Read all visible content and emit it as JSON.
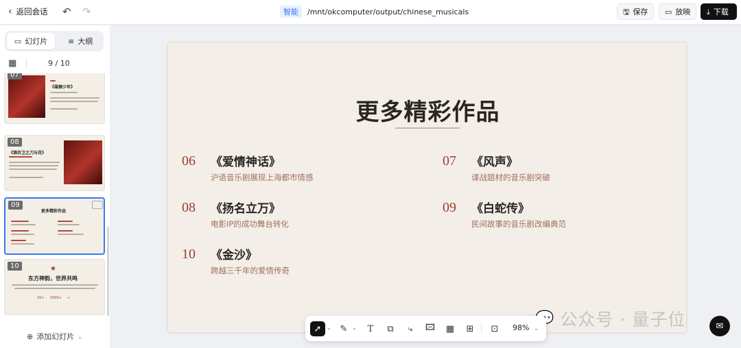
{
  "topbar": {
    "back_label": "返回会话",
    "mode_badge": "智能",
    "path": "/mnt/okcomputer/output/chinese_musicals",
    "save_label": "保存",
    "present_label": "放映",
    "download_label": "下载"
  },
  "sidebar": {
    "tab_slides": "幻灯片",
    "tab_outline": "大纲",
    "counter": "9 / 10",
    "add_slide": "添加幻灯片",
    "thumbs": [
      {
        "num": "07",
        "title": "《雄狮少年》"
      },
      {
        "num": "08",
        "title": "《锦衣卫之刀与花》"
      },
      {
        "num": "09",
        "title": "更多精彩作品"
      },
      {
        "num": "10",
        "title": "东方神韵，世界共鸣",
        "stats": [
          "10+",
          "1000+",
          "∞"
        ]
      }
    ]
  },
  "slide": {
    "title": "更多精彩作品",
    "items": [
      {
        "num": "06",
        "name": "《爱情神话》",
        "desc": "沪语音乐剧展现上海都市情感"
      },
      {
        "num": "07",
        "name": "《风声》",
        "desc": "谍战题材的音乐剧突破"
      },
      {
        "num": "08",
        "name": "《扬名立万》",
        "desc": "电影IP的成功舞台转化"
      },
      {
        "num": "09",
        "name": "《白蛇传》",
        "desc": "民间故事的音乐剧改编典范"
      },
      {
        "num": "10",
        "name": "《金沙》",
        "desc": "跨越三千年的爱情传奇"
      }
    ]
  },
  "toolbar": {
    "zoom": "98%"
  },
  "watermark": "公众号 · 量子位",
  "colors": {
    "accent_number": "#9a3c2f",
    "selection": "#3a78f2",
    "slide_bg": "#f3efe8"
  }
}
